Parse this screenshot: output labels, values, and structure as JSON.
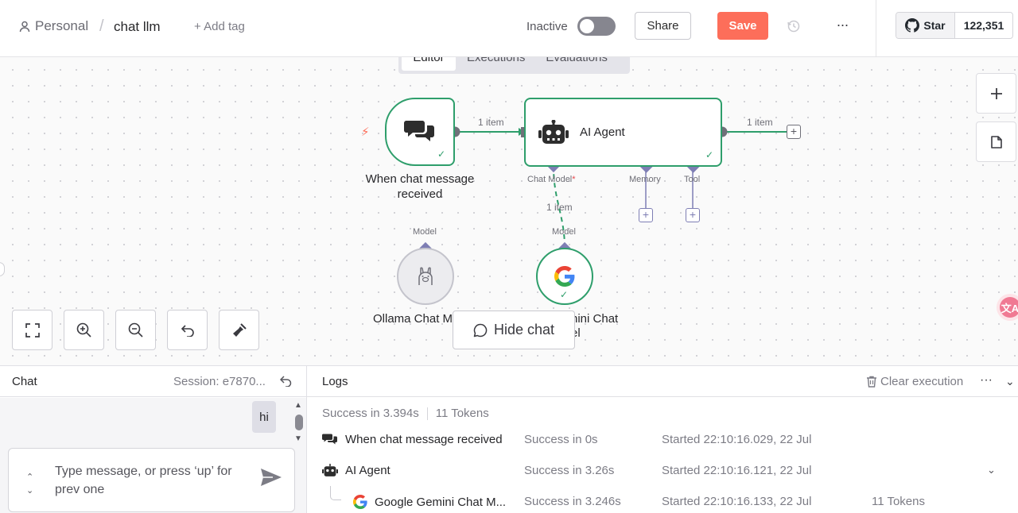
{
  "header": {
    "workspace": "Personal",
    "separator": "/",
    "workflow_name": "chat llm",
    "add_tag": "+ Add tag",
    "active_label": "Inactive",
    "share_label": "Share",
    "save_label": "Save",
    "more_label": "···",
    "github": {
      "star_label": "Star",
      "star_count": "122,351"
    }
  },
  "tabs": [
    {
      "label": "Editor",
      "active": true
    },
    {
      "label": "Executions",
      "active": false
    },
    {
      "label": "Evaluations",
      "active": false
    }
  ],
  "canvas": {
    "trigger_label": "When chat message received",
    "agent_label": "AI Agent",
    "conn1_label": "1 item",
    "conn2_label": "1 item",
    "model_conn_label": "1 item",
    "agent_ports": {
      "chat_model": "Chat Model",
      "required_mark": "*",
      "memory": "Memory",
      "tool": "Tool"
    },
    "model_port_label": "Model",
    "ollama_label": "Ollama Chat M",
    "gemini_label_line1": "nini Chat",
    "gemini_label_line2": "el",
    "hide_chat_label": "Hide chat",
    "translate_label": "文A"
  },
  "chat": {
    "title": "Chat",
    "session": "Session: e7870...",
    "messages": [
      {
        "role": "user",
        "text": "hi"
      }
    ],
    "input_placeholder": "Type message, or press ‘up’ for prev one"
  },
  "logs": {
    "title": "Logs",
    "clear_label": "Clear execution",
    "more_label": "···",
    "summary_status": "Success in 3.394s",
    "summary_tokens": "11 Tokens",
    "rows": [
      {
        "name": "When chat message received",
        "status": "Success in 0s",
        "started": "Started 22:10:16.029, 22 Jul",
        "tokens": ""
      },
      {
        "name": "AI Agent",
        "status": "Success in 3.26s",
        "started": "Started 22:10:16.121, 22 Jul",
        "tokens": ""
      },
      {
        "name": "Google Gemini Chat M...",
        "status": "Success in 3.246s",
        "started": "Started 22:10:16.133, 22 Jul",
        "tokens": "11 Tokens"
      }
    ]
  },
  "colors": {
    "accent": "#fd6e5a",
    "success": "#2e9e6b",
    "port": "#7e7eb4"
  }
}
